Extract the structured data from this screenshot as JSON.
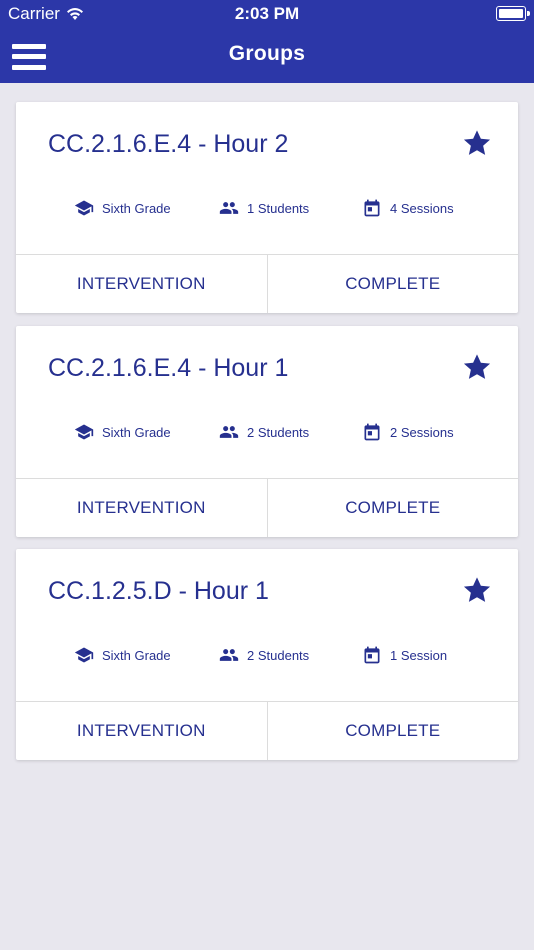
{
  "status_bar": {
    "carrier": "Carrier",
    "time": "2:03 PM"
  },
  "nav": {
    "title": "Groups"
  },
  "colors": {
    "primary": "#2c37a8",
    "text_accent": "#26308f",
    "background": "#e8e7ee"
  },
  "groups": [
    {
      "title": "CC.2.1.6.E.4 - Hour 2",
      "grade": "Sixth Grade",
      "students": "1 Students",
      "sessions": "4 Sessions",
      "intervention_label": "INTERVENTION",
      "complete_label": "COMPLETE"
    },
    {
      "title": "CC.2.1.6.E.4 - Hour 1",
      "grade": "Sixth Grade",
      "students": "2 Students",
      "sessions": "2 Sessions",
      "intervention_label": "INTERVENTION",
      "complete_label": "COMPLETE"
    },
    {
      "title": "CC.1.2.5.D - Hour 1",
      "grade": "Sixth Grade",
      "students": "2 Students",
      "sessions": "1 Session",
      "intervention_label": "INTERVENTION",
      "complete_label": "COMPLETE"
    }
  ]
}
